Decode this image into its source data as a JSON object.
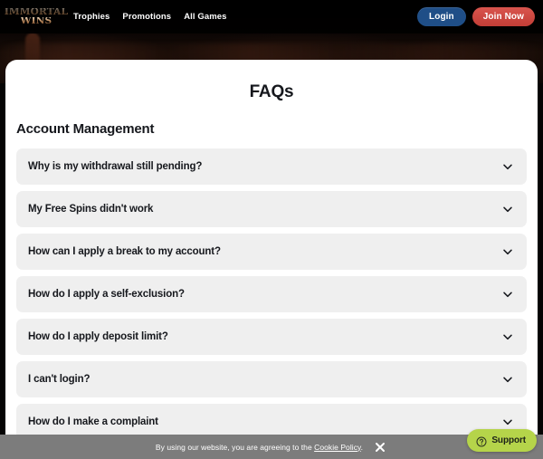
{
  "header": {
    "logo": {
      "line1": "IMMORTAL",
      "line2": "WINS",
      "name": "Immortal Wins"
    },
    "nav": [
      {
        "label": "Trophies"
      },
      {
        "label": "Promotions"
      },
      {
        "label": "All Games"
      }
    ],
    "login_label": "Login",
    "join_label": "Join Now"
  },
  "main": {
    "page_title": "FAQs",
    "section_title": "Account Management",
    "faqs": [
      {
        "question": "Why is my withdrawal still pending?",
        "icon": "chevron-down-icon",
        "expanded": false
      },
      {
        "question": "My Free Spins didn't work",
        "icon": "chevron-down-icon",
        "expanded": false
      },
      {
        "question": "How can I apply a break to my account?",
        "icon": "chevron-down-icon",
        "expanded": false
      },
      {
        "question": "How do I apply a self-exclusion?",
        "icon": "chevron-down-icon",
        "expanded": false
      },
      {
        "question": "How do I apply deposit limit?",
        "icon": "chevron-down-icon",
        "expanded": false
      },
      {
        "question": "I can't login?",
        "icon": "chevron-down-icon",
        "expanded": false
      },
      {
        "question": "How do I make a complaint",
        "icon": "chevron-down-icon",
        "expanded": false
      }
    ]
  },
  "cookie_banner": {
    "text_before": "By using our website, you are agreeing to the",
    "link_label": "Cookie Policy",
    "text_after": ".",
    "close_icon": "close-icon"
  },
  "support_widget": {
    "label": "Support",
    "icon": "question-circle-icon"
  },
  "colors": {
    "page_background": "#050404",
    "card_background": "#ffffff",
    "accordion_row": "#efefef",
    "text_primary": "#16181d",
    "login_button": "#1f4e87",
    "join_button": "#c23d36",
    "cookie_bar": "#7c7c7c",
    "support_green": "#b5d44a",
    "logo_bronze": "#c8996a"
  }
}
